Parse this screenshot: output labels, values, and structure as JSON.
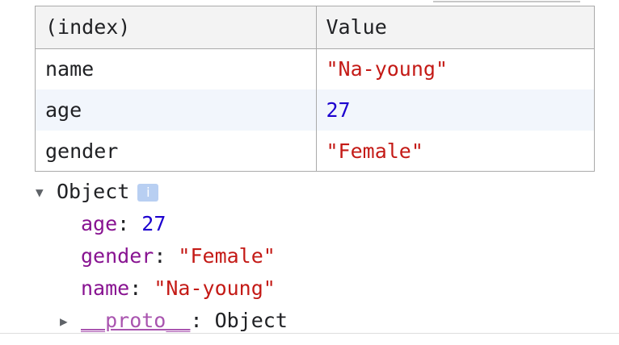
{
  "table": {
    "columns": [
      "(index)",
      "Value"
    ],
    "rows": [
      {
        "index": "name",
        "value": "\"Na-young\""
      },
      {
        "index": "age",
        "value": "27"
      },
      {
        "index": "gender",
        "value": "\"Female\""
      }
    ]
  },
  "object_tree": {
    "label": "Object",
    "info_glyph": "i",
    "properties": [
      {
        "key": "age",
        "value": "27"
      },
      {
        "key": "gender",
        "value": "\"Female\""
      },
      {
        "key": "name",
        "value": "\"Na-young\""
      }
    ],
    "proto": {
      "key": "__proto__",
      "value": "Object"
    }
  },
  "syntax_colors": {
    "string": "#c41a16",
    "number": "#1c00cf",
    "key": "#881391",
    "plain": "#202124"
  },
  "icons": {
    "expand_caret": "triangle-down",
    "collapsed_caret": "triangle-right",
    "info": "info-badge"
  }
}
